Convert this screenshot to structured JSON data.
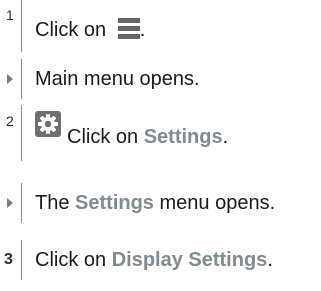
{
  "steps": [
    {
      "marker": "1",
      "text": "Click on ",
      "icon": "hamburger-menu-icon",
      "after": "."
    },
    {
      "marker": "▶",
      "text": "Main menu opens."
    },
    {
      "marker": "2",
      "icon": "gear-icon",
      "text_before": "Click on ",
      "highlight": "Settings",
      "after": "."
    },
    {
      "marker": "▶",
      "text_before": "The ",
      "highlight": "Settings",
      "text_after": " menu opens."
    },
    {
      "marker": "3",
      "text_before": "Click on ",
      "highlight": "Display Settings",
      "after": "."
    }
  ],
  "colors": {
    "highlight": "#7f8b90",
    "text": "#1a1a1a",
    "rule": "#8a8a8a"
  }
}
